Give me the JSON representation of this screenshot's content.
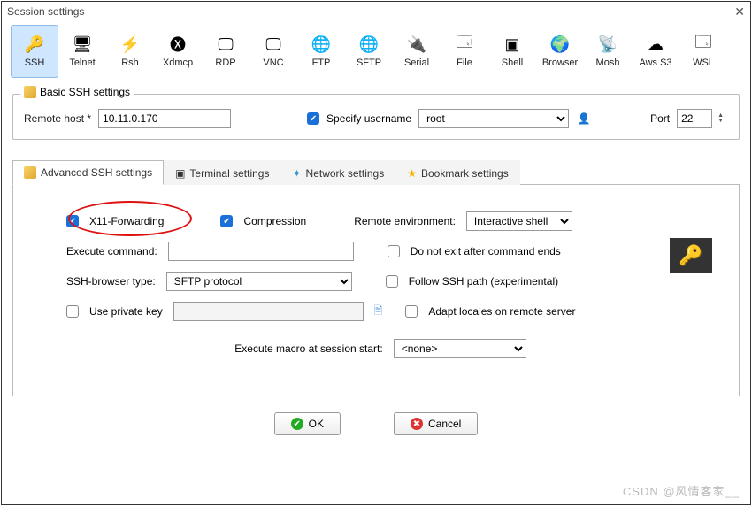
{
  "window": {
    "title": "Session settings"
  },
  "protocols": [
    {
      "label": "SSH",
      "icon": "🔑",
      "selected": true
    },
    {
      "label": "Telnet",
      "icon": "🖥"
    },
    {
      "label": "Rsh",
      "icon": "⚡"
    },
    {
      "label": "Xdmcp",
      "icon": "🅧"
    },
    {
      "label": "RDP",
      "icon": "🖵"
    },
    {
      "label": "VNC",
      "icon": "🖵"
    },
    {
      "label": "FTP",
      "icon": "🌐"
    },
    {
      "label": "SFTP",
      "icon": "🌐"
    },
    {
      "label": "Serial",
      "icon": "🔌"
    },
    {
      "label": "File",
      "icon": "🗔"
    },
    {
      "label": "Shell",
      "icon": "▣"
    },
    {
      "label": "Browser",
      "icon": "🌍"
    },
    {
      "label": "Mosh",
      "icon": "📡"
    },
    {
      "label": "Aws S3",
      "icon": "☁"
    },
    {
      "label": "WSL",
      "icon": "🗔"
    }
  ],
  "basic": {
    "legend": "Basic SSH settings",
    "remote_host_label": "Remote host *",
    "remote_host_value": "10.11.0.170",
    "specify_username_label": "Specify username",
    "specify_username_checked": true,
    "username_value": "root",
    "port_label": "Port",
    "port_value": "22"
  },
  "tabs": {
    "advanced": "Advanced SSH settings",
    "terminal": "Terminal settings",
    "network": "Network settings",
    "bookmark": "Bookmark settings"
  },
  "advanced": {
    "x11_label": "X11-Forwarding",
    "x11_checked": true,
    "compression_label": "Compression",
    "compression_checked": true,
    "remote_env_label": "Remote environment:",
    "remote_env_value": "Interactive shell",
    "exec_cmd_label": "Execute command:",
    "exec_cmd_value": "",
    "do_not_exit_label": "Do not exit after command ends",
    "do_not_exit_checked": false,
    "browser_type_label": "SSH-browser type:",
    "browser_type_value": "SFTP protocol",
    "follow_ssh_label": "Follow SSH path (experimental)",
    "follow_ssh_checked": false,
    "private_key_label": "Use private key",
    "private_key_checked": false,
    "private_key_value": "",
    "adapt_locales_label": "Adapt locales on remote server",
    "adapt_locales_checked": false,
    "macro_label": "Execute macro at session start:",
    "macro_value": "<none>"
  },
  "buttons": {
    "ok": "OK",
    "cancel": "Cancel"
  },
  "watermark": "CSDN @风情客家__"
}
